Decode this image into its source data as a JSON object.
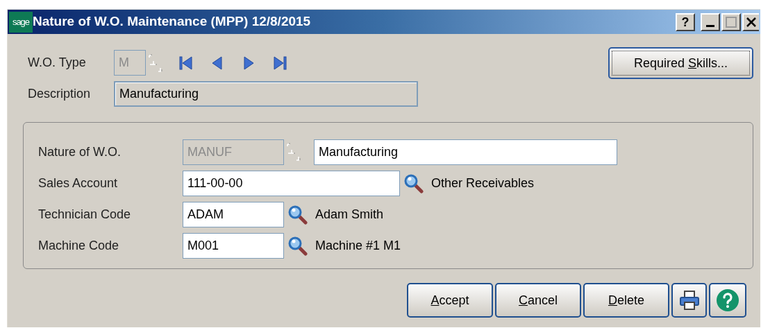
{
  "window": {
    "logo": "sage",
    "title": "Nature of W.O. Maintenance (MPP) 12/8/2015",
    "help_button": "?"
  },
  "header": {
    "wo_type": {
      "label": "W.O. Type",
      "value": "M",
      "disabled": true
    },
    "description": {
      "label": "Description",
      "value": "Manufacturing"
    },
    "required_skills_button": {
      "pre": "Required ",
      "key": "S",
      "post": "kills..."
    }
  },
  "fields": [
    {
      "kind": "list",
      "label": "Nature of W.O.",
      "value": "MANUF",
      "disabled": true,
      "description": "Manufacturing"
    },
    {
      "kind": "search",
      "label": "Sales Account",
      "value": "111-00-00",
      "disabled": false,
      "description": "Other Receivables"
    },
    {
      "kind": "search",
      "label": "Technician Code",
      "value": "ADAM",
      "disabled": false,
      "description": "Adam Smith"
    },
    {
      "kind": "search",
      "label": "Machine Code",
      "value": "M001",
      "disabled": false,
      "description": "Machine #1 M1"
    }
  ],
  "buttons": [
    {
      "kind": "text",
      "key": "A",
      "post": "ccept"
    },
    {
      "kind": "text",
      "key": "C",
      "post": "ancel"
    },
    {
      "kind": "text",
      "key": "D",
      "post": "elete"
    },
    {
      "kind": "print"
    },
    {
      "kind": "help"
    }
  ]
}
